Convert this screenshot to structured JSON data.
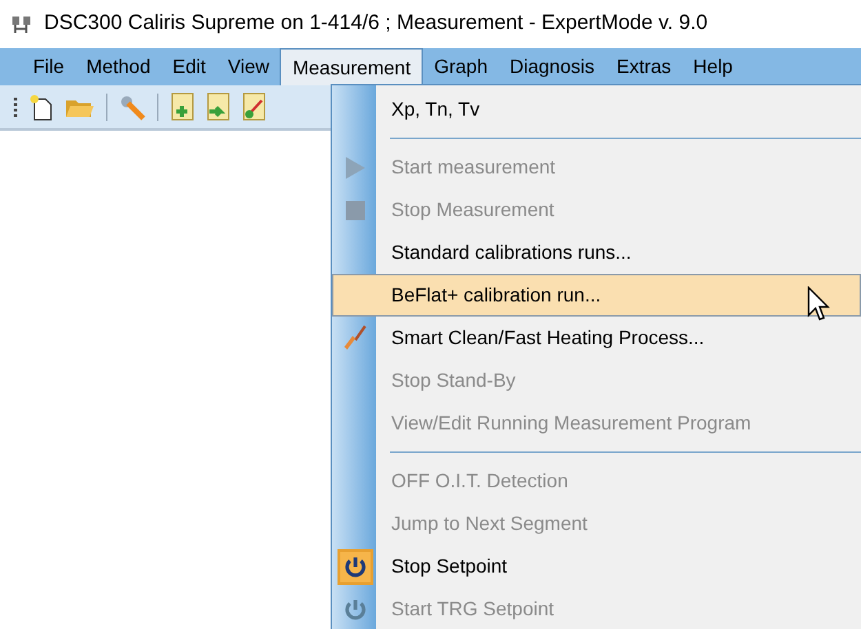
{
  "window": {
    "title": "DSC300 Caliris Supreme on 1-414/6 ; Measurement - ExpertMode v. 9.0"
  },
  "menubar": [
    {
      "label": "File",
      "selected": false
    },
    {
      "label": "Method",
      "selected": false
    },
    {
      "label": "Edit",
      "selected": false
    },
    {
      "label": "View",
      "selected": false
    },
    {
      "label": "Measurement",
      "selected": true
    },
    {
      "label": "Graph",
      "selected": false
    },
    {
      "label": "Diagnosis",
      "selected": false
    },
    {
      "label": "Extras",
      "selected": false
    },
    {
      "label": "Help",
      "selected": false
    }
  ],
  "menu": [
    {
      "kind": "plain",
      "label": "Xp, Tn, Tv",
      "disabled": false,
      "selected": false
    },
    {
      "kind": "separator"
    },
    {
      "kind": "play",
      "label": "Start measurement",
      "disabled": true,
      "selected": false
    },
    {
      "kind": "stop",
      "label": "Stop Measurement",
      "disabled": true,
      "selected": false
    },
    {
      "kind": "plain",
      "label": "Standard calibrations runs...",
      "disabled": false,
      "selected": false
    },
    {
      "kind": "plain",
      "label": "BeFlat+ calibration run...",
      "disabled": false,
      "selected": true
    },
    {
      "kind": "brush",
      "label": "Smart Clean/Fast Heating Process...",
      "disabled": false,
      "selected": false
    },
    {
      "kind": "plain",
      "label": "Stop Stand-By",
      "disabled": true,
      "selected": false
    },
    {
      "kind": "plain",
      "label": "View/Edit Running Measurement Program",
      "disabled": true,
      "selected": false
    },
    {
      "kind": "separator"
    },
    {
      "kind": "plain",
      "label": "OFF O.I.T. Detection",
      "disabled": true,
      "selected": false
    },
    {
      "kind": "plain",
      "label": "Jump to Next Segment",
      "disabled": true,
      "selected": false
    },
    {
      "kind": "power",
      "label": "Stop Setpoint",
      "disabled": false,
      "selected": false,
      "checked": true
    },
    {
      "kind": "power",
      "label": "Start TRG Setpoint",
      "disabled": true,
      "selected": false,
      "checked": false
    }
  ]
}
